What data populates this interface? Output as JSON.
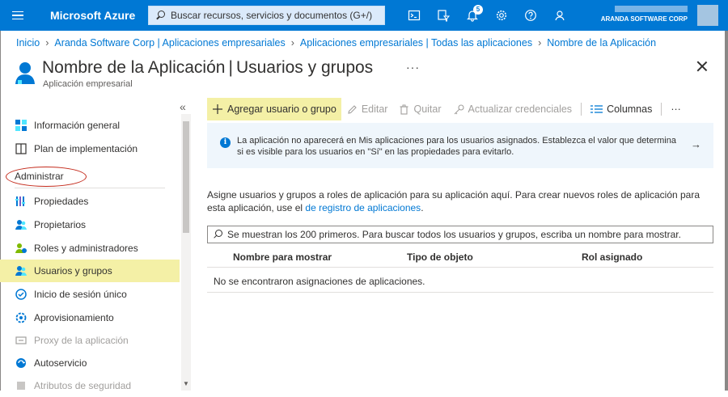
{
  "topbar": {
    "brand": "Microsoft Azure",
    "search_placeholder": "Buscar recursos, servicios y documentos (G+/)",
    "notification_count": "5",
    "tenant": "ARANDA SOFTWARE CORP",
    "icons": [
      "cloud-shell-icon",
      "directory-filter-icon",
      "bell-icon",
      "gear-icon",
      "help-icon",
      "feedback-icon"
    ],
    "accent": "#0078d4"
  },
  "breadcrumb": [
    "Inicio",
    "Aranda Software Corp | Aplicaciones empresariales",
    "Aplicaciones empresariales | Todas las aplicaciones",
    "Nombre de la Aplicación"
  ],
  "header": {
    "app_name": "Nombre de la Aplicación",
    "page_name": "Usuarios y grupos",
    "subtitle": "Aplicación empresarial",
    "more": "···"
  },
  "sidebar": {
    "collapse_glyph": "«",
    "items_top": [
      {
        "label": "Información general",
        "icon": "info-grid-icon"
      },
      {
        "label": "Plan de implementación",
        "icon": "book-icon"
      }
    ],
    "section": "Administrar",
    "items": [
      {
        "label": "Propiedades",
        "icon": "properties-icon",
        "state": "normal"
      },
      {
        "label": "Propietarios",
        "icon": "owners-icon",
        "state": "normal"
      },
      {
        "label": "Roles y administradores",
        "icon": "roles-icon",
        "state": "normal"
      },
      {
        "label": "Usuarios y grupos",
        "icon": "users-groups-icon",
        "state": "active"
      },
      {
        "label": "Inicio de sesión único",
        "icon": "sso-icon",
        "state": "normal"
      },
      {
        "label": "Aprovisionamiento",
        "icon": "provisioning-icon",
        "state": "normal"
      },
      {
        "label": "Proxy de la aplicación",
        "icon": "proxy-icon",
        "state": "disabled"
      },
      {
        "label": "Autoservicio",
        "icon": "self-service-icon",
        "state": "normal"
      },
      {
        "label": "Atributos de seguridad",
        "icon": "security-attributes-icon",
        "state": "disabled"
      }
    ]
  },
  "toolbar": {
    "add": "Agregar usuario o grupo",
    "edit": "Editar",
    "remove": "Quitar",
    "update_credentials": "Actualizar credenciales",
    "columns": "Columnas",
    "more": "···"
  },
  "info_banner": {
    "message": "La aplicación no aparecerá en Mis aplicaciones para los usuarios asignados. Establezca el valor que determina si es visible para los usuarios en \"Sí\" en las propiedades para evitarlo.",
    "arrow": "→"
  },
  "description": {
    "text": "Asigne usuarios y grupos a roles de aplicación para su aplicación aquí. Para crear nuevos roles de aplicación para esta aplicación, use el",
    "link": "de registro de aplicaciones",
    "end": "."
  },
  "filter": {
    "placeholder": "Se muestran los 200 primeros. Para buscar todos los usuarios y grupos, escriba un nombre para mostrar."
  },
  "table": {
    "columns": [
      "Nombre para mostrar",
      "Tipo de objeto",
      "Rol asignado"
    ],
    "empty_message": "No se encontraron asignaciones de aplicaciones."
  }
}
